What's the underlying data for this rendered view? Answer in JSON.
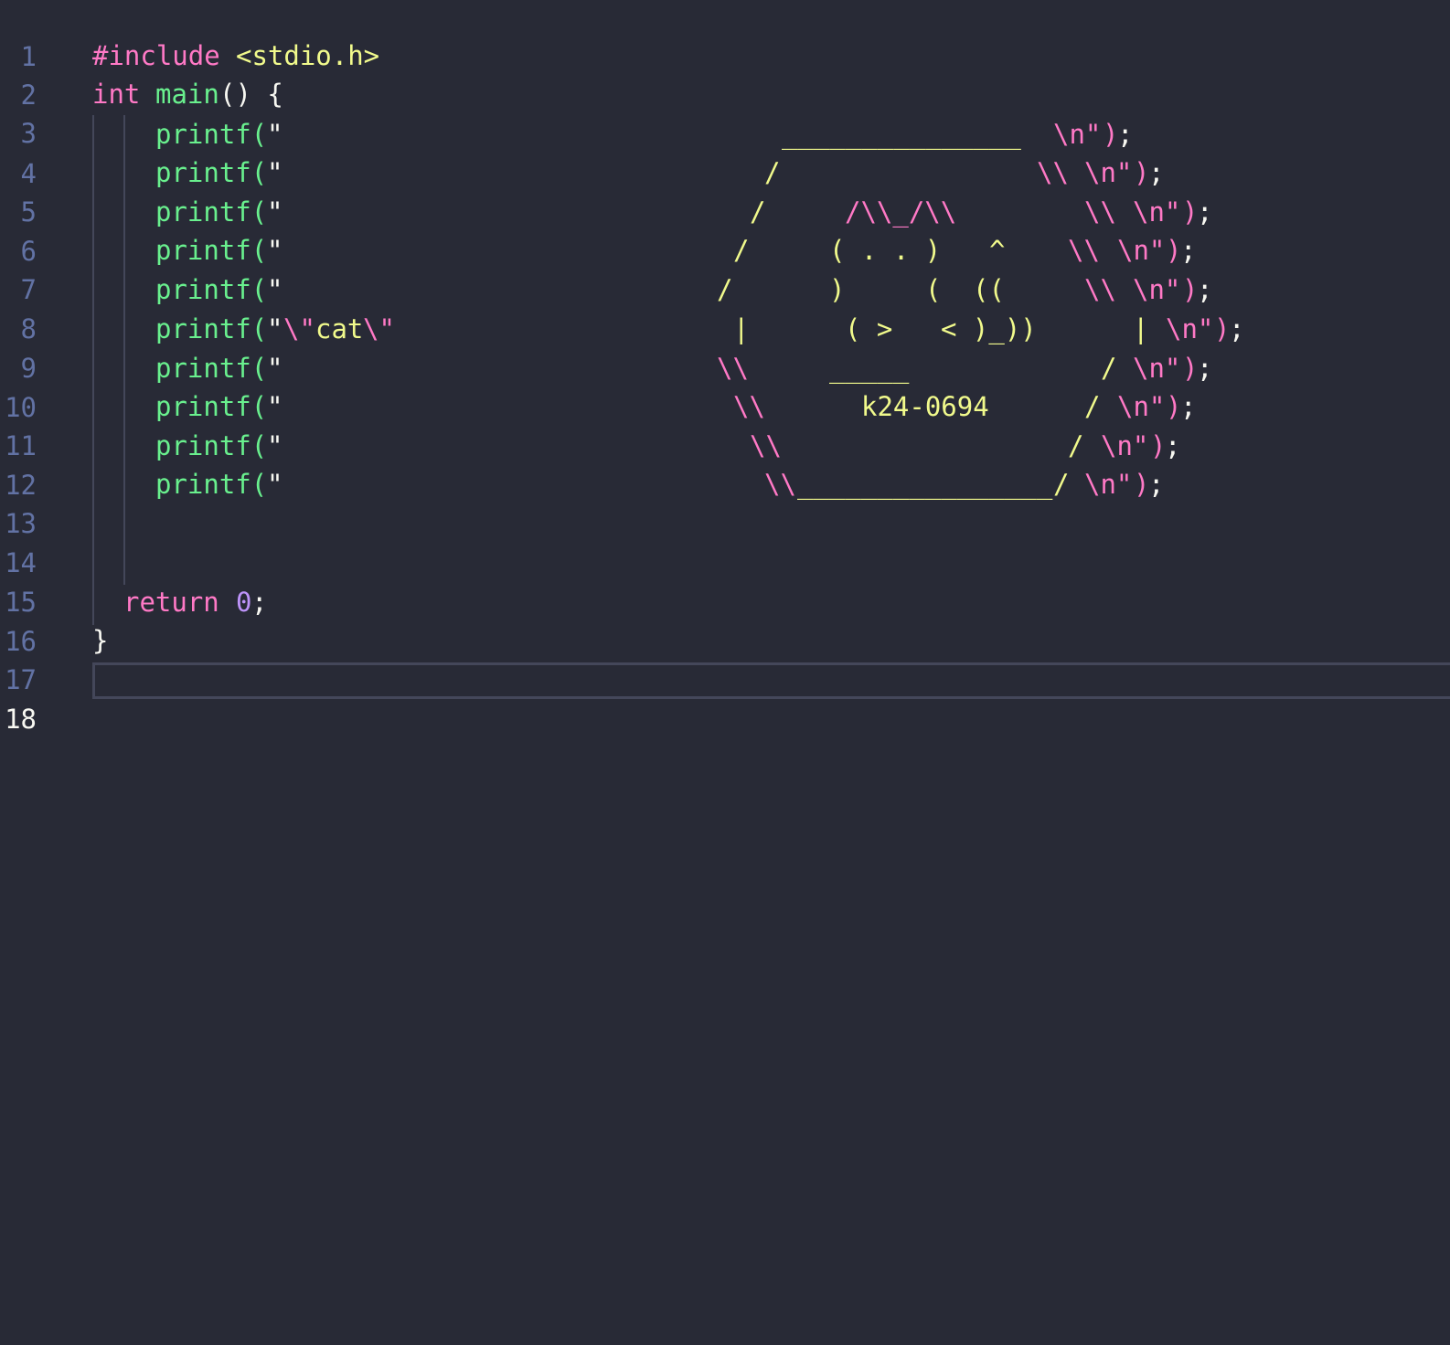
{
  "editor": {
    "line_numbers": [
      "1",
      "2",
      "3",
      "4",
      "5",
      "6",
      "7",
      "8",
      "9",
      "10",
      "11",
      "12",
      "13",
      "14",
      "15",
      "16",
      "17",
      "18"
    ],
    "active_line": "18",
    "lines": {
      "l2": {
        "directive": "#include",
        "header": "<stdio.h>"
      },
      "l3": {
        "type": "int",
        "name": "main",
        "rest": "() {"
      },
      "l4": {
        "call": "printf(",
        "quote_open": "\"",
        "art": "_______________",
        "esc": "\\n\"",
        "close": ")",
        "semi": ";"
      },
      "l5": {
        "call": "printf(",
        "quote_open": "\"",
        "art_a": "/",
        "art_b": "\\\\",
        "esc": "\\n\"",
        "close": ")",
        "semi": ";"
      },
      "l6": {
        "call": "printf(",
        "quote_open": "\"",
        "art_a": "/",
        "art_b": "/\\\\_/\\\\",
        "art_c": "\\\\",
        "esc": "\\n\"",
        "close": ")",
        "semi": ";"
      },
      "l7": {
        "call": "printf(",
        "quote_open": "\"",
        "art_a": "/",
        "art_b": "( . . )",
        "art_c": "^",
        "art_d": "\\\\",
        "esc": "\\n\"",
        "close": ")",
        "semi": ";"
      },
      "l8": {
        "call": "printf(",
        "quote_open": "\"",
        "art_a": "/",
        "art_b": ")",
        "art_c": "(",
        "art_d": "((",
        "art_e": "\\\\",
        "esc": "\\n\"",
        "close": ")",
        "semi": ";"
      },
      "l9": {
        "call": "printf(",
        "quote_open": "\"",
        "esc1": "\\\"",
        "word": "cat",
        "esc2": "\\\"",
        "art_a": "|",
        "art_b": "( >",
        "art_c": "< )_))",
        "art_d": "|",
        "esc": "\\n\"",
        "close": ")",
        "semi": ";"
      },
      "l10": {
        "call": "printf(",
        "quote_open": "\"",
        "art_a": "\\\\",
        "art_b": "_____",
        "art_c": "/",
        "esc": "\\n\"",
        "close": ")",
        "semi": ";"
      },
      "l11": {
        "call": "printf(",
        "quote_open": "\"",
        "art_a": "\\\\",
        "art_b": "k24-0694",
        "art_c": "/",
        "esc": "\\n\"",
        "close": ")",
        "semi": ";"
      },
      "l12": {
        "call": "printf(",
        "quote_open": "\"",
        "art_a": "\\\\",
        "art_c": "/",
        "esc": "\\n\"",
        "close": ")",
        "semi": ";"
      },
      "l13": {
        "call": "printf(",
        "quote_open": "\"",
        "art_a": "\\\\",
        "art_b": "________________",
        "art_c": "/",
        "esc": "\\n\"",
        "close": ")",
        "semi": ";"
      },
      "l16": {
        "keyword": "return",
        "number": "0",
        "semi": ";"
      },
      "l17": {
        "brace": "}"
      }
    }
  }
}
